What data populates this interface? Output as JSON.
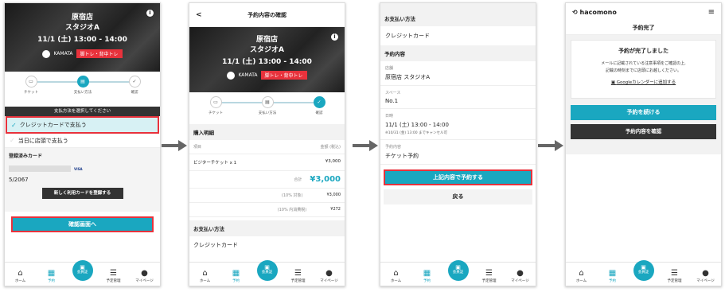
{
  "hero": {
    "line1": "原宿店",
    "line2": "スタジオA",
    "datetime": "11/1 (土) 13:00 - 14:00",
    "instructor": "KAMATA",
    "tag": "脚トレ・背中トレ"
  },
  "steps": [
    "チケット",
    "支払い方法",
    "確認"
  ],
  "tabbar": [
    "ホーム",
    "予約",
    "会員証",
    "予定管理",
    "マイページ"
  ],
  "screen1": {
    "pay_header": "支払方法を選択してください",
    "option_card": "クレジットカードで支払う",
    "option_store": "当日に店頭で支払う",
    "registered_card_title": "登録済みカード",
    "card_brand": "VISA",
    "card_expiry": "5/2067",
    "register_new_label": "新しく利用カードを登録する",
    "confirm_label": "確認画面へ"
  },
  "screen2": {
    "nav_title": "予約内容の確認",
    "back_glyph": "<",
    "detail_title": "購入明細",
    "col_item": "項目",
    "col_amount": "金額 (税込)",
    "item_name": "ビジターチケット x 1",
    "item_price": "¥3,000",
    "total_label": "合計",
    "total_value": "¥3,000",
    "tax_target_label": "(10% 対象)",
    "tax_target_value": "¥3,000",
    "tax_inner_label": "(10% 内消費税)",
    "tax_inner_value": "¥272",
    "pay_method_title": "お支払い方法",
    "pay_method_value": "クレジットカード"
  },
  "screen3": {
    "pay_method_title": "お支払い方法",
    "pay_method_value": "クレジットカード",
    "reservation_title": "予約内容",
    "store_label": "店舗",
    "store_value": "原宿店 スタジオA",
    "space_label": "スペース",
    "space_value": "No.1",
    "datetime_label": "日時",
    "datetime_value": "11/1 (土) 13:00 - 14:00",
    "cancel_note": "※10/31 (金) 13:00 までキャンセル可",
    "content_label": "予約内容",
    "content_value": "チケット予約",
    "submit_label": "上記内容で予約する",
    "back_label": "戻る"
  },
  "screen4": {
    "logo_text": "hacomono",
    "menu_glyph": "≡",
    "title": "予約完了",
    "heading": "予約が完了しました",
    "message1": "メールに記載されている注意事項をご確認の上,",
    "message2": "記載の時刻までに店頭にお越しください。",
    "calendar_link": "Googleカレンダーに追加する",
    "continue_label": "予約を続ける",
    "check_label": "予約内容を確認"
  },
  "colors": {
    "accent": "#1aa7c0",
    "highlight": "#e8323c",
    "dark": "#333333"
  }
}
